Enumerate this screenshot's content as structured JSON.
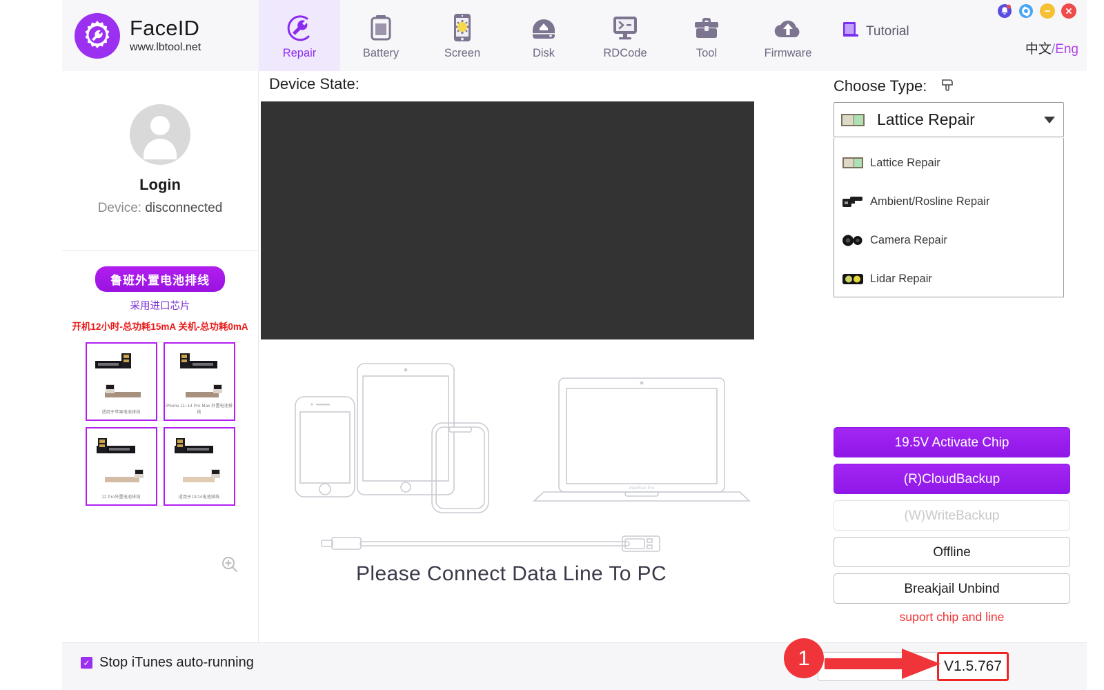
{
  "brand": {
    "title": "FaceID",
    "website": "www.lbtool.net",
    "logo_icon": "gear-wrench-icon"
  },
  "header": {
    "tabs": [
      {
        "label": "Repair",
        "icon": "wrench-circle-icon",
        "active": true
      },
      {
        "label": "Battery",
        "icon": "battery-icon",
        "active": false
      },
      {
        "label": "Screen",
        "icon": "phone-screen-icon",
        "active": false
      },
      {
        "label": "Disk",
        "icon": "disk-icon",
        "active": false
      },
      {
        "label": "RDCode",
        "icon": "terminal-icon",
        "active": false
      },
      {
        "label": "Tool",
        "icon": "toolbox-icon",
        "active": false
      },
      {
        "label": "Firmware",
        "icon": "cloud-upload-icon",
        "active": false
      }
    ],
    "tutorial_label": "Tutorial",
    "tutorial_icon": "book-icon",
    "window_controls": [
      {
        "name": "notification-bell-icon",
        "color": "#5b4de0"
      },
      {
        "name": "settings-gear-icon",
        "color": "#49a6f5"
      },
      {
        "name": "minimize-icon",
        "color": "#f5c033"
      },
      {
        "name": "close-icon",
        "color": "#ee4b4b"
      }
    ],
    "language": {
      "cn": "中文",
      "sep": "/",
      "en": "Eng"
    }
  },
  "sidebar": {
    "login_label": "Login",
    "device_key": "Device:",
    "device_value": "disconnected",
    "avatar_icon": "user-avatar-icon",
    "promo": {
      "pill": "鲁班外置电池排线",
      "sub": "采用进口芯片",
      "spec": "开机12小时-总功耗15mA  关机-总功耗0mA"
    },
    "thumbnails": [
      {
        "caption": "适用于苹果电池排线"
      },
      {
        "caption": "iPhone 11~14 Pro Max 外置电池排线"
      },
      {
        "caption": "12 Pro外置电池排线"
      },
      {
        "caption": "适用于13/14电池排线"
      }
    ],
    "zoom_icon": "zoom-in-icon"
  },
  "main": {
    "device_state_label": "Device State:",
    "log_content": "",
    "connect_message": "Please Connect Data Line To PC",
    "illustration_icons": [
      "iphone-icon",
      "ipad-icon",
      "iphone-x-icon",
      "macbook-icon",
      "usb-cable-icon"
    ],
    "macbook_caption": "MacBook Pro"
  },
  "choose_type": {
    "label": "Choose Type:",
    "pointer_icon": "hand-pointer-icon",
    "selected": "Lattice Repair",
    "selected_icon": "lattice-module-icon",
    "caret_icon": "chevron-down-icon",
    "options": [
      {
        "label": "Lattice Repair",
        "icon": "lattice-module-icon"
      },
      {
        "label": "Ambient/Rosline Repair",
        "icon": "ambient-sensor-icon"
      },
      {
        "label": "Camera Repair",
        "icon": "camera-lens-icon"
      },
      {
        "label": "Lidar Repair",
        "icon": "lidar-module-icon"
      }
    ]
  },
  "actions": {
    "buttons": [
      {
        "label": "19.5V Activate Chip",
        "style": "primary"
      },
      {
        "label": "(R)CloudBackup",
        "style": "primary"
      },
      {
        "label": "(W)WriteBackup",
        "style": "disabled"
      },
      {
        "label": "Offline",
        "style": "normal"
      },
      {
        "label": "Breakjail Unbind",
        "style": "normal"
      }
    ],
    "support_note": "suport chip and line"
  },
  "footer": {
    "checkbox_label": "Stop iTunes auto-running",
    "checkbox_checked": true,
    "check_glyph": "✓",
    "obscured_button_label": "",
    "version": "V1.5.767"
  },
  "annotation": {
    "step_number": "1",
    "arrow_icon": "right-arrow-icon",
    "color": "#f0353a"
  },
  "colors": {
    "accent_purple": "#9b30f0",
    "tab_active_bg": "#f0e9fd",
    "header_bg": "#f7f7f9",
    "log_bg": "#333333",
    "red": "#ef2424"
  }
}
